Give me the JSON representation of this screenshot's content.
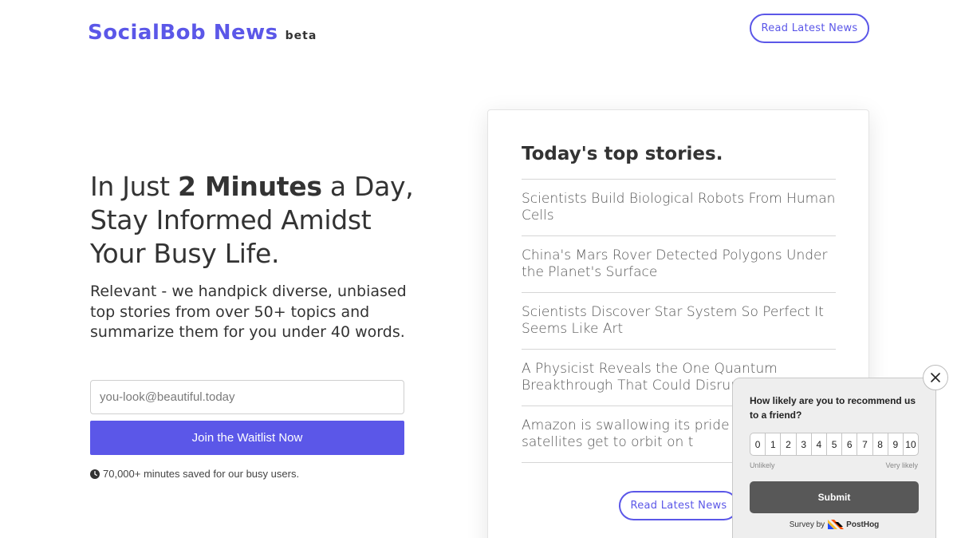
{
  "header": {
    "logo_text": "SocialBob News",
    "logo_badge": "beta",
    "cta_label": "Read Latest News"
  },
  "hero": {
    "title_prefix": "In Just ",
    "title_bold": "2 Minutes",
    "title_suffix": " a Day, Stay Informed Amidst Your Busy Life.",
    "subtitle": "Relevant - we handpick diverse, unbiased top stories from over 50+ topics and summarize them for you under 40 words.",
    "email_placeholder": "you-look@beautiful.today",
    "join_label": "Join the Waitlist Now",
    "stat_text": "70,000+ minutes saved for our busy users."
  },
  "card": {
    "title": "Today's top stories.",
    "stories": [
      "Scientists Build Biological Robots From Human Cells",
      "China's Mars Rover Detected Polygons Under the Planet's Surface",
      "Scientists Discover Star System So Perfect It Seems Like Art",
      "A Physicist Reveals the One Quantum Breakthrough That Could Disrupt Innovation",
      "Amazon is swallowing its pride to internet satellites get to orbit on t"
    ],
    "cta_label": "Read Latest News"
  },
  "survey": {
    "question": "How likely are you to recommend us to a friend?",
    "ratings": [
      "0",
      "1",
      "2",
      "3",
      "4",
      "5",
      "6",
      "7",
      "8",
      "9",
      "10"
    ],
    "low_label": "Unlikely",
    "high_label": "Very likely",
    "submit_label": "Submit",
    "by_label": "Survey by",
    "brand": "PostHog"
  },
  "colors": {
    "accent": "#5b57e8",
    "survey_bg": "#eeeeee",
    "submit_bg": "#585858"
  },
  "icons": [
    "clock-icon",
    "close-icon",
    "posthog-logo-icon"
  ]
}
